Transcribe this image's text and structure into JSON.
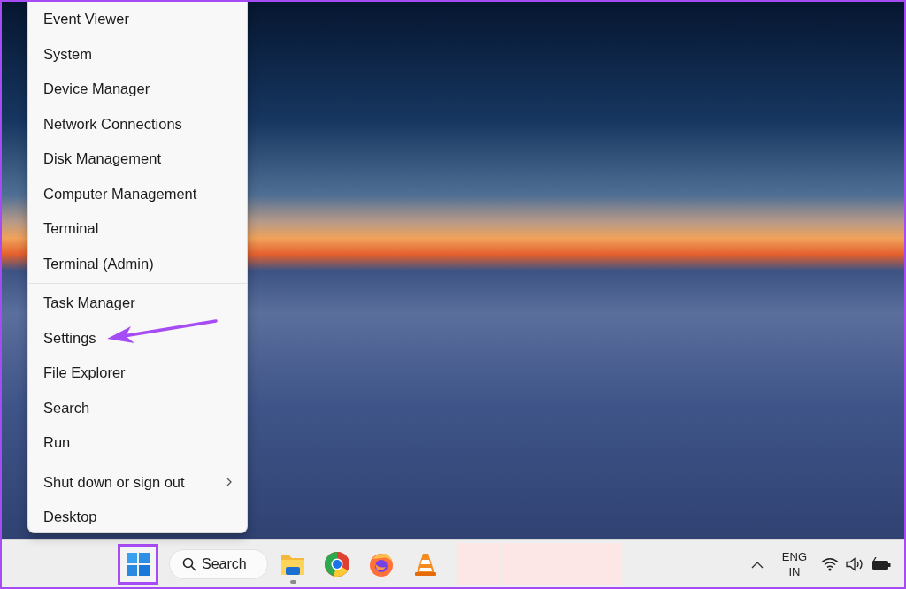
{
  "context_menu": {
    "groups": [
      {
        "items": [
          {
            "label": "Event Viewer",
            "submenu": false,
            "annotated": false
          },
          {
            "label": "System",
            "submenu": false,
            "annotated": false
          },
          {
            "label": "Device Manager",
            "submenu": false,
            "annotated": false
          },
          {
            "label": "Network Connections",
            "submenu": false,
            "annotated": false
          },
          {
            "label": "Disk Management",
            "submenu": false,
            "annotated": false
          },
          {
            "label": "Computer Management",
            "submenu": false,
            "annotated": false
          },
          {
            "label": "Terminal",
            "submenu": false,
            "annotated": false
          },
          {
            "label": "Terminal (Admin)",
            "submenu": false,
            "annotated": false
          }
        ]
      },
      {
        "items": [
          {
            "label": "Task Manager",
            "submenu": false,
            "annotated": false
          },
          {
            "label": "Settings",
            "submenu": false,
            "annotated": true
          },
          {
            "label": "File Explorer",
            "submenu": false,
            "annotated": false
          },
          {
            "label": "Search",
            "submenu": false,
            "annotated": false
          },
          {
            "label": "Run",
            "submenu": false,
            "annotated": false
          }
        ]
      },
      {
        "items": [
          {
            "label": "Shut down or sign out",
            "submenu": true,
            "annotated": false
          },
          {
            "label": "Desktop",
            "submenu": false,
            "annotated": false
          }
        ]
      }
    ]
  },
  "taskbar": {
    "start": {
      "annotated": true
    },
    "search": {
      "label": "Search"
    },
    "apps": [
      {
        "kind": "files",
        "running": true
      },
      {
        "kind": "chrome",
        "running": false
      },
      {
        "kind": "firefox",
        "running": false
      },
      {
        "kind": "vlc",
        "running": false
      }
    ],
    "tray": {
      "language": "ENG",
      "region": "IN"
    }
  }
}
